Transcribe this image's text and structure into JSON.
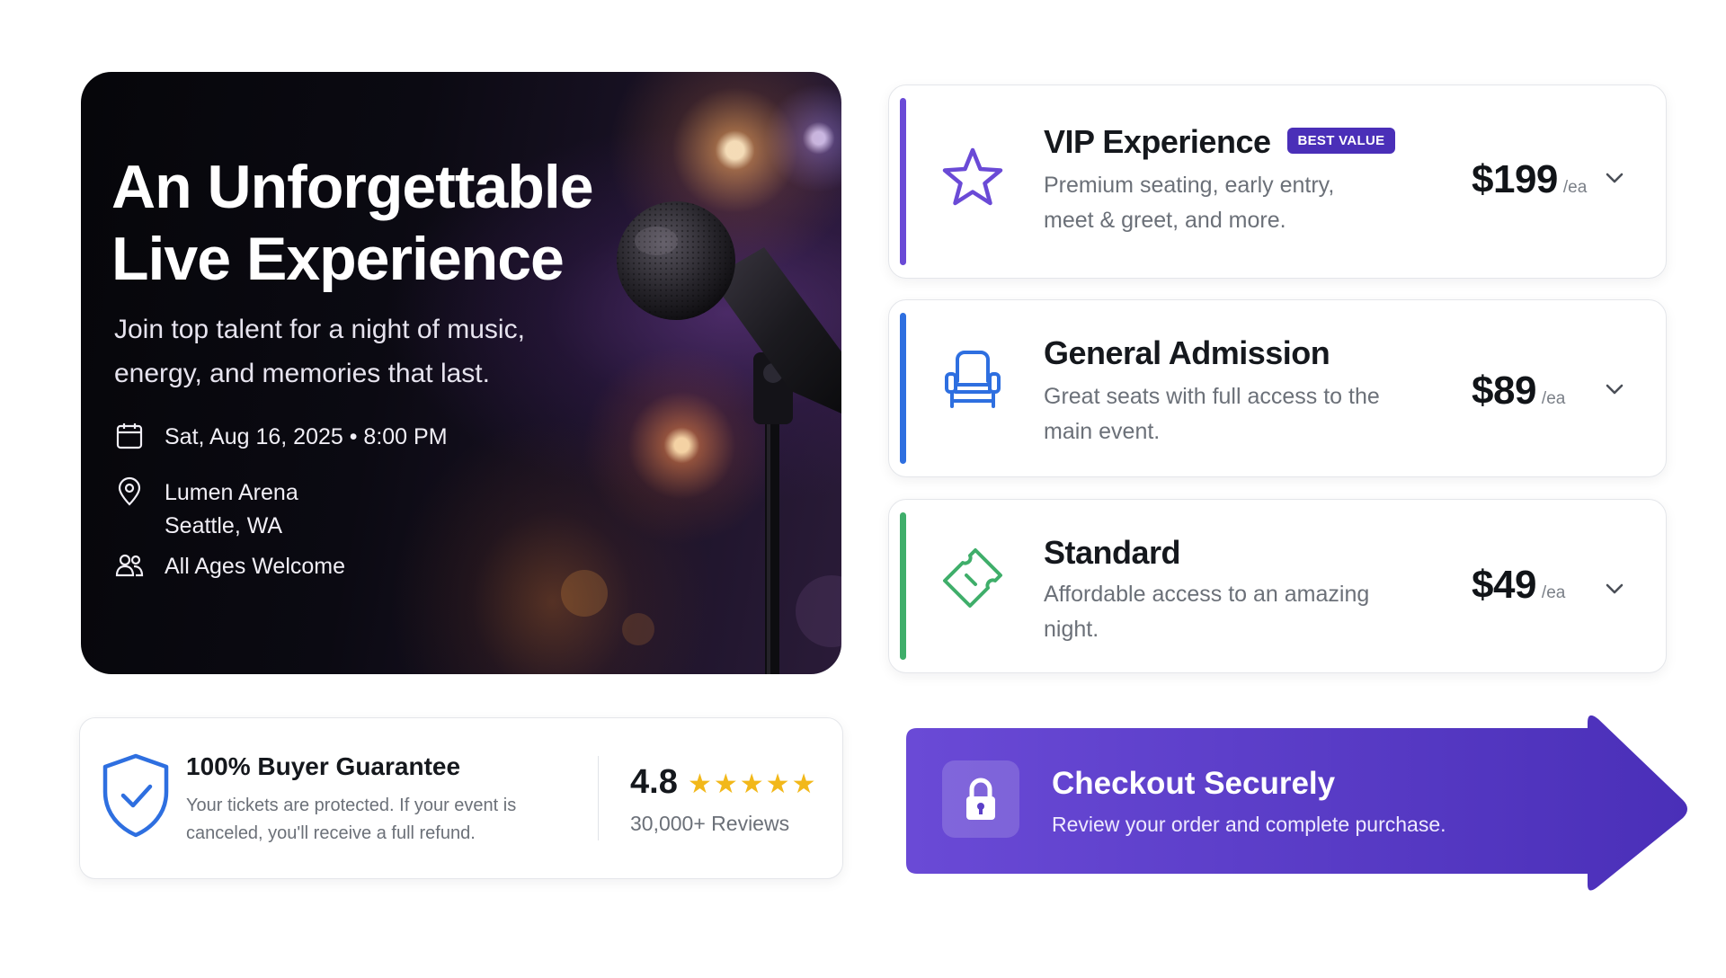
{
  "hero": {
    "title_line1": "An Unforgettable",
    "title_line2": "Live Experience",
    "subtitle": "Join top talent for a night of music, energy, and memories that last.",
    "date": "Sat, Aug 16, 2025 • 8:00 PM",
    "venue": "Lumen Arena",
    "city": "Seattle, WA",
    "ages": "All Ages Welcome"
  },
  "tickets": [
    {
      "name": "VIP Experience",
      "badge": "BEST VALUE",
      "desc": "Premium seating, early entry, meet & greet, and more.",
      "price": "$199",
      "unit": "/ea",
      "icon": "star-icon",
      "accent": "#6a4ad6"
    },
    {
      "name": "General Admission",
      "desc": "Great seats with full access to the main event.",
      "price": "$89",
      "unit": "/ea",
      "icon": "seat-icon",
      "accent": "#2e6fe0"
    },
    {
      "name": "Standard",
      "desc": "Affordable access to an amazing night.",
      "price": "$49",
      "unit": "/ea",
      "icon": "ticket-icon",
      "accent": "#3fae6a"
    }
  ],
  "guarantee": {
    "title": "100% Buyer Guarantee",
    "text": "Your tickets are protected. If your event is canceled, you'll receive a full refund.",
    "rating": "4.8",
    "stars": "★★★★★",
    "reviews": "30,000+ Reviews",
    "star_color": "#f2b81a"
  },
  "checkout": {
    "title": "Checkout Securely",
    "subtitle": "Review your order and complete purchase.",
    "gradient_start": "#6a4ad6",
    "gradient_end": "#4a2fb8"
  }
}
